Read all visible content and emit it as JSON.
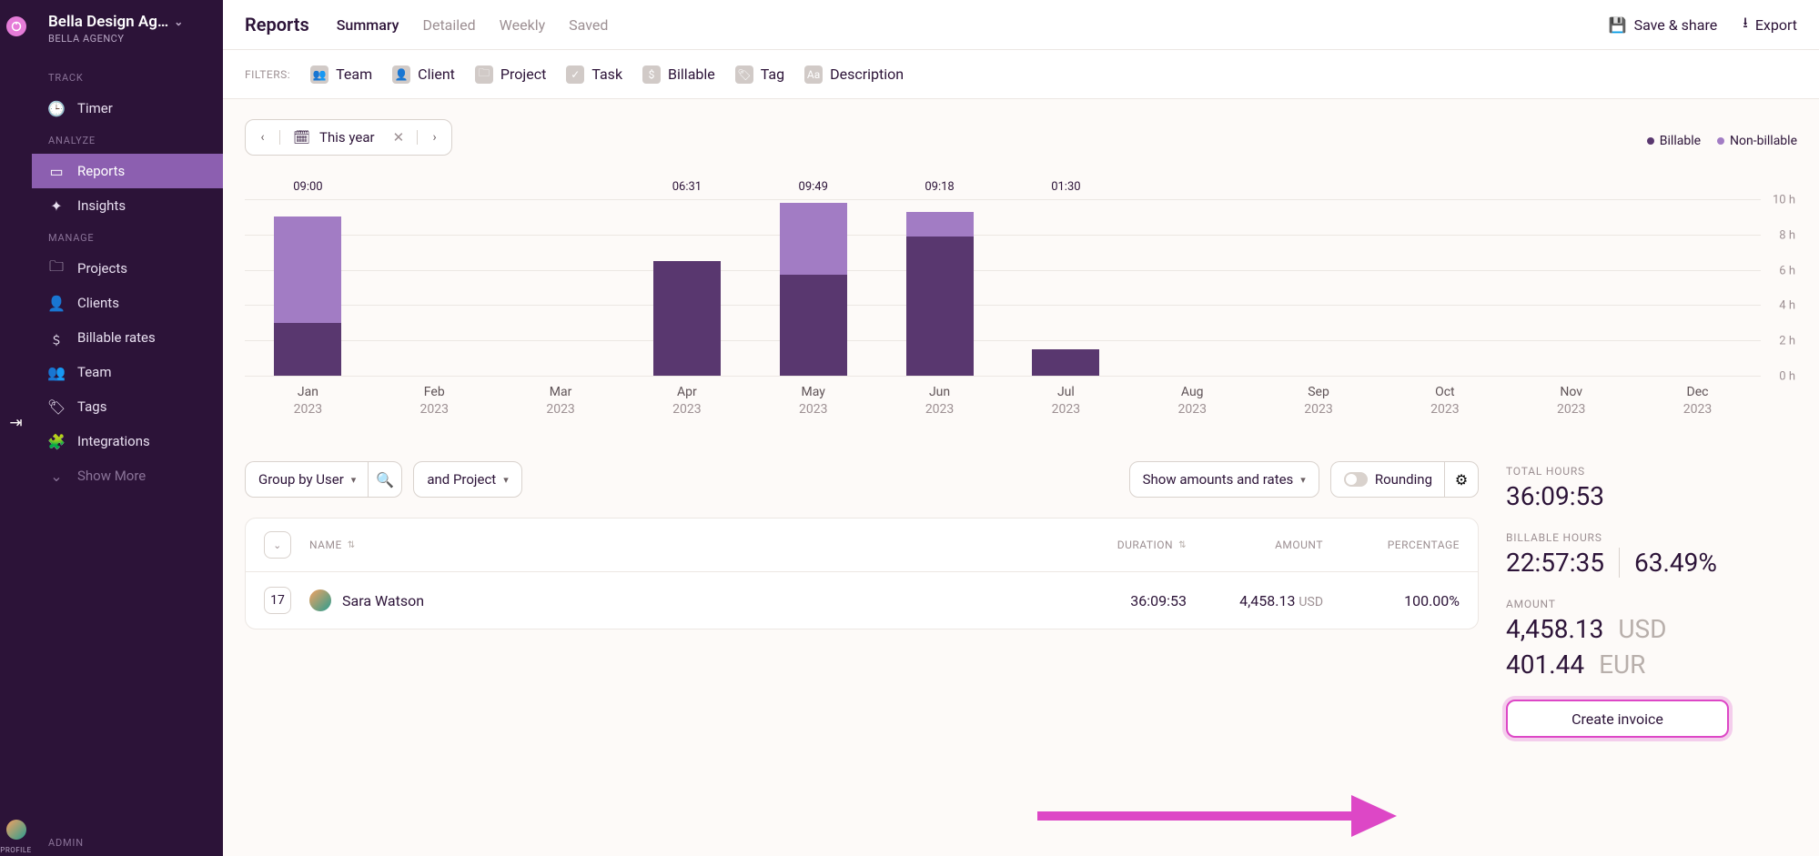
{
  "workspace": {
    "name": "Bella Design Ag…",
    "sub": "BELLA AGENCY"
  },
  "nav": {
    "track": "TRACK",
    "timer": "Timer",
    "analyze": "ANALYZE",
    "reports": "Reports",
    "insights": "Insights",
    "manage": "MANAGE",
    "projects": "Projects",
    "clients": "Clients",
    "billable_rates": "Billable rates",
    "team": "Team",
    "tags": "Tags",
    "integrations": "Integrations",
    "show_more": "Show More",
    "admin": "ADMIN",
    "profile": "PROFILE"
  },
  "header": {
    "title": "Reports",
    "tabs": {
      "summary": "Summary",
      "detailed": "Detailed",
      "weekly": "Weekly",
      "saved": "Saved"
    },
    "save_share": "Save & share",
    "export": "Export"
  },
  "filters": {
    "label": "FILTERS:",
    "team": "Team",
    "client": "Client",
    "project": "Project",
    "task": "Task",
    "billable": "Billable",
    "tag": "Tag",
    "description": "Description"
  },
  "daterange": {
    "value": "This year"
  },
  "legend": {
    "billable": "Billable",
    "nonbillable": "Non-billable"
  },
  "chart_data": {
    "type": "bar",
    "categories": [
      "Jan",
      "Feb",
      "Mar",
      "Apr",
      "May",
      "Jun",
      "Jul",
      "Aug",
      "Sep",
      "Oct",
      "Nov",
      "Dec"
    ],
    "year": "2023",
    "series": [
      {
        "name": "Billable",
        "values": [
          3.0,
          0,
          0,
          6.52,
          5.7,
          7.9,
          1.5,
          0,
          0,
          0,
          0,
          0
        ]
      },
      {
        "name": "Non-billable",
        "values": [
          6.0,
          0,
          0,
          0,
          4.1,
          1.4,
          0,
          0,
          0,
          0,
          0,
          0
        ]
      }
    ],
    "bar_labels": [
      "09:00",
      "",
      "",
      "06:31",
      "09:49",
      "09:18",
      "01:30",
      "",
      "",
      "",
      "",
      ""
    ],
    "ylabel": "hours",
    "ylim": [
      0,
      10
    ],
    "yticks": [
      0,
      2,
      4,
      6,
      8,
      10
    ],
    "ytick_labels": [
      "0 h",
      "2 h",
      "4 h",
      "6 h",
      "8 h",
      "10 h"
    ],
    "colors": {
      "billable": "#59376f",
      "nonbillable": "#a27cc4"
    }
  },
  "controls": {
    "group_by": "Group by User",
    "and_project": "and Project",
    "show_amounts": "Show amounts and rates",
    "rounding": "Rounding"
  },
  "table": {
    "headers": {
      "name": "NAME",
      "duration": "DURATION",
      "amount": "AMOUNT",
      "percentage": "PERCENTAGE"
    },
    "rows": [
      {
        "count": "17",
        "name": "Sara Watson",
        "duration": "36:09:53",
        "amount": "4,458.13",
        "currency": "USD",
        "percentage": "100.00%"
      }
    ]
  },
  "summary": {
    "total_hours_label": "TOTAL HOURS",
    "total_hours": "36:09:53",
    "billable_hours_label": "BILLABLE HOURS",
    "billable_hours": "22:57:35",
    "billable_pct": "63.49%",
    "amount_label": "AMOUNT",
    "amount_usd": "4,458.13",
    "amount_usd_cur": "USD",
    "amount_eur": "401.44",
    "amount_eur_cur": "EUR",
    "create_invoice": "Create invoice"
  }
}
